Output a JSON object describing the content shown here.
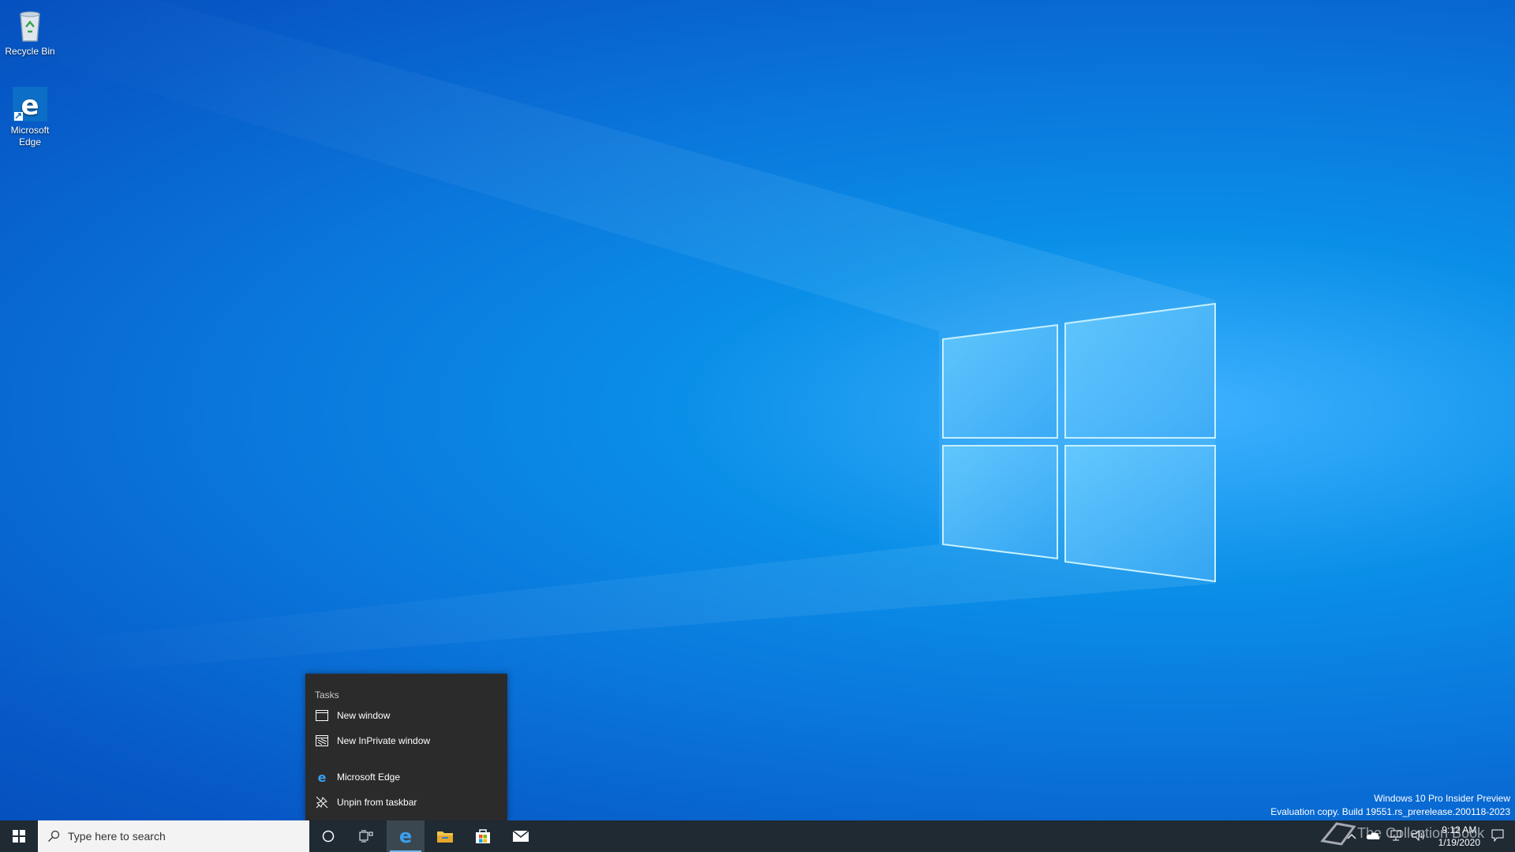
{
  "desktop": {
    "icons": [
      {
        "label": "Recycle Bin",
        "icon": "recycle-bin-icon"
      },
      {
        "label": "Microsoft Edge",
        "icon": "edge-icon"
      }
    ]
  },
  "jumplist": {
    "section_title": "Tasks",
    "items": [
      {
        "label": "New window",
        "icon": "window-icon"
      },
      {
        "label": "New InPrivate window",
        "icon": "inprivate-icon"
      },
      {
        "label": "Microsoft Edge",
        "icon": "edge-icon"
      },
      {
        "label": "Unpin from taskbar",
        "icon": "unpin-icon"
      }
    ]
  },
  "taskbar": {
    "search_placeholder": "Type here to search",
    "apps": [
      "cortana-icon",
      "task-view-icon",
      "edge-icon",
      "file-explorer-icon",
      "store-icon",
      "mail-icon"
    ]
  },
  "watermark": {
    "line1": "Windows 10 Pro Insider Preview",
    "line2": "Evaluation copy. Build 19551.rs_prerelease.200118-2023"
  },
  "tray": {
    "time": "9:12 AM",
    "date": "1/19/2020"
  },
  "overlay_text": "The Collection Book",
  "colors": {
    "accent": "#0a78dc",
    "taskbar": "#1f2a33",
    "menu": "#2b2b2b"
  }
}
